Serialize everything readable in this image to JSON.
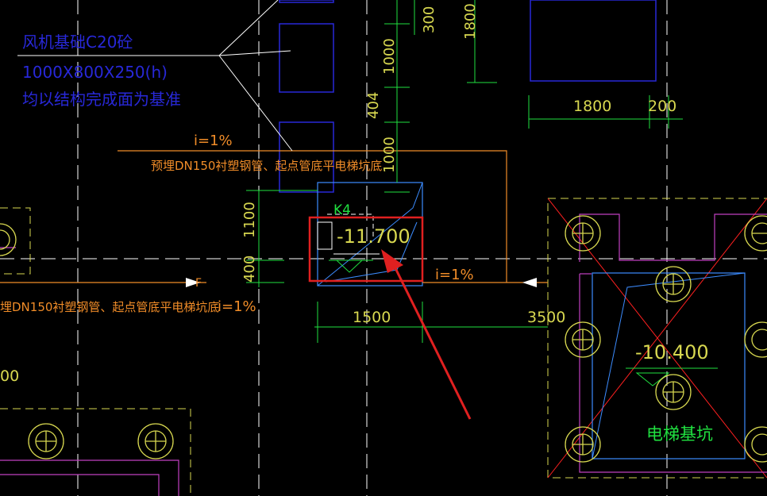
{
  "notes": {
    "fan_base_line1": "风机基础C20砼",
    "fan_base_line2": "1000X800X250(h)",
    "fan_base_line3": "均以结构完成面为基准",
    "slope_top": "i=1%",
    "pipe_note_top": "预埋DN150衬塑钢管、起点管底平电梯坑底",
    "pipe_note_left": "埋DN150衬塑钢管、起点管底平电梯坑底",
    "slope_left": "i=1%",
    "slope_right": "i=1%",
    "pit_label_small": "K4",
    "pit_elevation": "-11.700",
    "elevator_elevation": "-10.400",
    "elevator_pit_label": "电梯基坑",
    "flow_mark": "F"
  },
  "dimensions": {
    "d300": "300",
    "d1800_vertical": "1800",
    "d1000_upper": "1000",
    "d404": "404",
    "d1000_lower": "1000",
    "d1100": "1100",
    "d400": "400",
    "d1500": "1500",
    "d3500": "3500",
    "d1800_horizontal": "1800",
    "d200": "200",
    "d_left_partial": "00"
  },
  "colors": {
    "background": "#000000",
    "white": "#ffffff",
    "yellow": "#d8d850",
    "green_dim": "#20e040",
    "orange": "#f08c28",
    "blue": "#2828d8",
    "cyan_blue": "#3c8cff",
    "magenta": "#c040c0",
    "red": "#ff2020",
    "highlight_red": "#e02020"
  }
}
